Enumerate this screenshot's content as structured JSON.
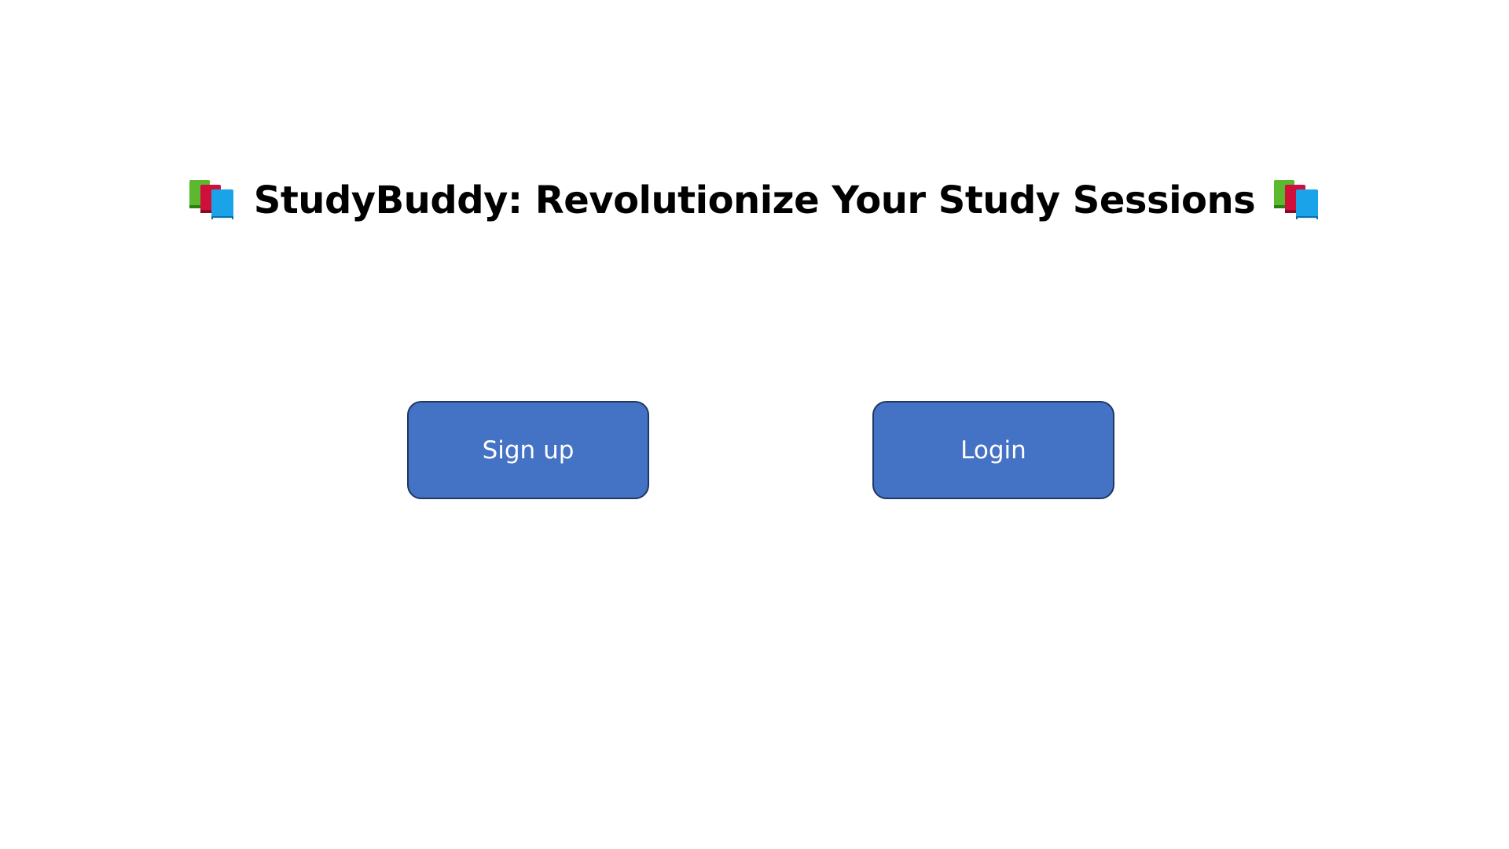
{
  "header": {
    "title": "StudyBuddy: Revolutionize Your Study Sessions",
    "left_icon": "books-icon",
    "right_icon": "books-icon"
  },
  "actions": {
    "signup_label": "Sign up",
    "login_label": "Login"
  },
  "colors": {
    "button_fill": "#4472c4",
    "button_border": "#1f3763",
    "button_text": "#ffffff",
    "title_text": "#000000",
    "background": "#ffffff",
    "book_green": "#5cb82e",
    "book_red": "#d0103a",
    "book_blue": "#1aa3e8"
  }
}
